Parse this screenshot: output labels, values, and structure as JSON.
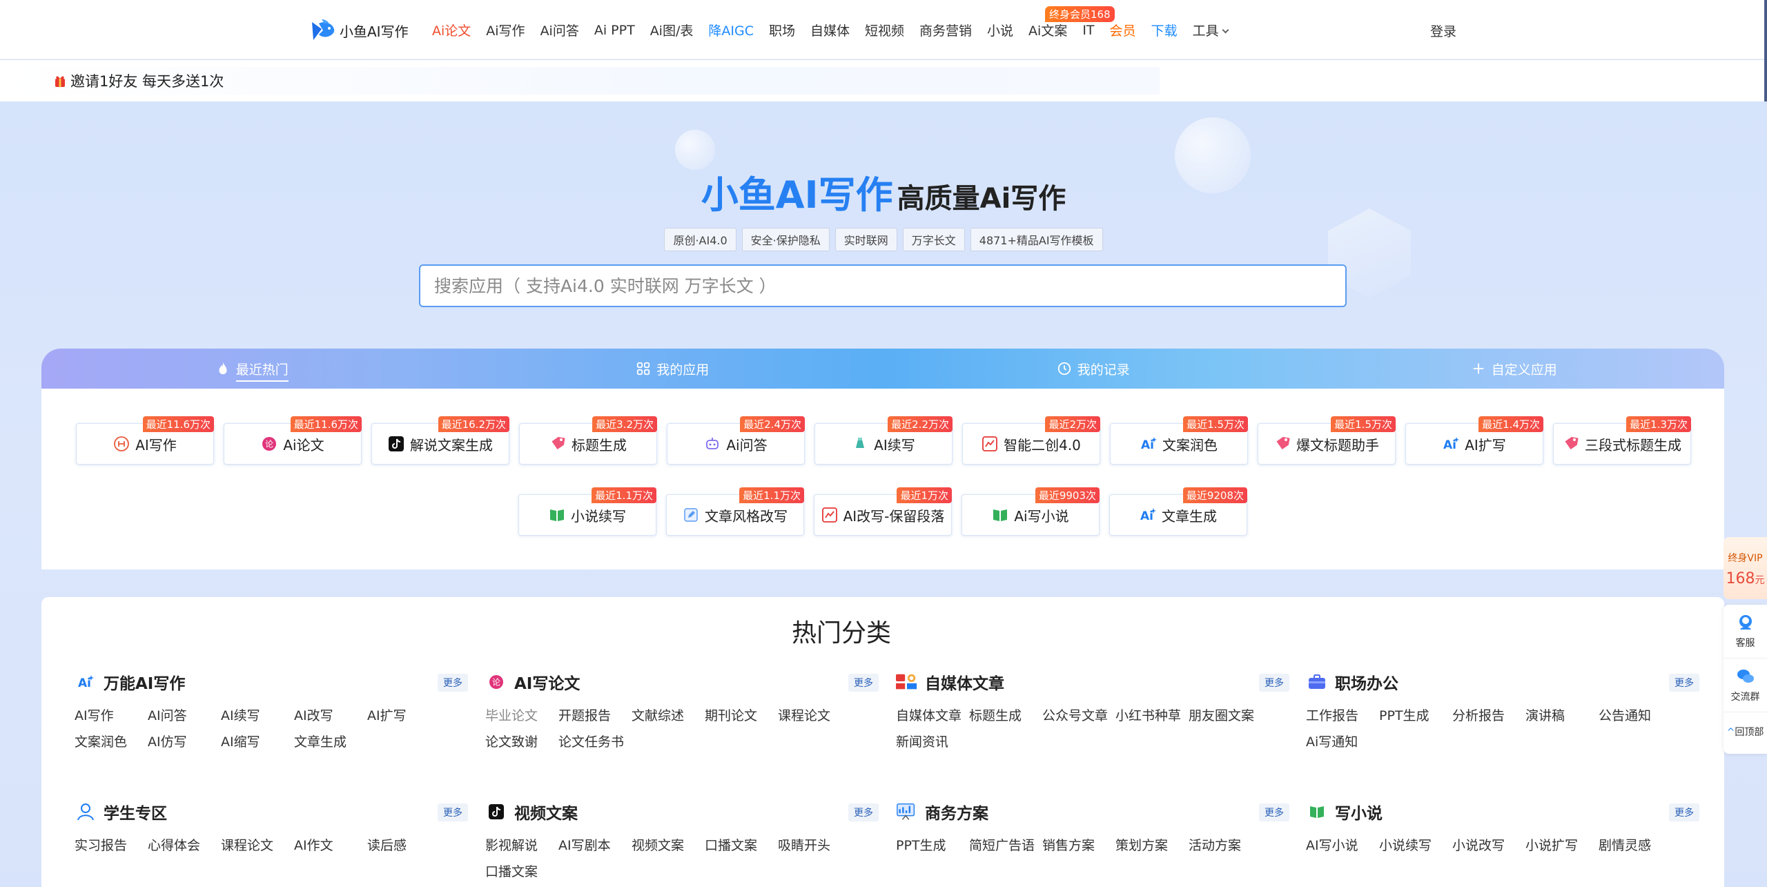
{
  "nav": {
    "brand": "小鱼AI写作",
    "items": [
      {
        "label": "Ai论文",
        "color": "red"
      },
      {
        "label": "Ai写作",
        "color": ""
      },
      {
        "label": "Ai问答",
        "color": ""
      },
      {
        "label": "Ai PPT",
        "color": ""
      },
      {
        "label": "Ai图/表",
        "color": ""
      },
      {
        "label": "降AIGC",
        "color": "blue"
      },
      {
        "label": "职场",
        "color": ""
      },
      {
        "label": "自媒体",
        "color": ""
      },
      {
        "label": "短视频",
        "color": ""
      },
      {
        "label": "商务营销",
        "color": ""
      },
      {
        "label": "小说",
        "color": ""
      },
      {
        "label": "Ai文案",
        "color": ""
      },
      {
        "label": "IT",
        "color": ""
      },
      {
        "label": "会员",
        "color": "orange"
      },
      {
        "label": "下载",
        "color": "blue"
      },
      {
        "label": "工具",
        "color": ""
      }
    ],
    "vip_badge": "终身会员168",
    "login": "登录"
  },
  "invite": {
    "text": "邀请1好友 每天多送1次"
  },
  "hero": {
    "title_main": "小鱼AI写作",
    "title_sub": "高质量Ai写作",
    "tags": [
      "原创·AI4.0",
      "安全·保护隐私",
      "实时联网",
      "万字长文",
      "4871+精品AI写作模板"
    ],
    "search_placeholder": "搜索应用（ 支持Ai4.0 实时联网 万字长文 ）"
  },
  "tabs": [
    {
      "label": "最近热门",
      "icon": "flame-icon"
    },
    {
      "label": "我的应用",
      "icon": "grid-icon"
    },
    {
      "label": "我的记录",
      "icon": "clock-icon"
    },
    {
      "label": "自定义应用",
      "icon": "plus-icon"
    }
  ],
  "apps": [
    {
      "label": "AI写作",
      "badge": "最近11.6万次",
      "icon": "write-icon"
    },
    {
      "label": "Ai论文",
      "badge": "最近11.6万次",
      "icon": "thesis-icon"
    },
    {
      "label": "解说文案生成",
      "badge": "最近16.2万次",
      "icon": "tiktok-icon"
    },
    {
      "label": "标题生成",
      "badge": "最近3.2万次",
      "icon": "tag-icon"
    },
    {
      "label": "Ai问答",
      "badge": "最近2.4万次",
      "icon": "robot-icon"
    },
    {
      "label": "AI续写",
      "badge": "最近2.2万次",
      "icon": "pen-icon"
    },
    {
      "label": "智能二创4.0",
      "badge": "最近2万次",
      "icon": "chart-icon"
    },
    {
      "label": "文案润色",
      "badge": "最近1.5万次",
      "icon": "ai-spark-icon"
    },
    {
      "label": "爆文标题助手",
      "badge": "最近1.5万次",
      "icon": "tag-icon"
    },
    {
      "label": "AI扩写",
      "badge": "最近1.4万次",
      "icon": "ai-spark-icon"
    },
    {
      "label": "三段式标题生成",
      "badge": "最近1.3万次",
      "icon": "tag-icon"
    },
    {
      "label": "小说续写",
      "badge": "最近1.1万次",
      "icon": "book-icon"
    },
    {
      "label": "文章风格改写",
      "badge": "最近1.1万次",
      "icon": "edit-icon"
    },
    {
      "label": "AI改写-保留段落",
      "badge": "最近1万次",
      "icon": "chart-icon"
    },
    {
      "label": "Ai写小说",
      "badge": "最近9903次",
      "icon": "book-icon"
    },
    {
      "label": "文章生成",
      "badge": "最近9208次",
      "icon": "ai-spark-icon"
    }
  ],
  "categories_title": "热门分类",
  "categories": [
    {
      "title": "万能AI写作",
      "icon": "ai-spark-icon",
      "more": "更多",
      "links": [
        "AI写作",
        "AI问答",
        "AI续写",
        "AI改写",
        "AI扩写",
        "文案润色",
        "AI仿写",
        "AI缩写",
        "文章生成"
      ]
    },
    {
      "title": "AI写论文",
      "icon": "thesis-icon",
      "more": "更多",
      "links": [
        "毕业论文",
        "开题报告",
        "文献综述",
        "期刊论文",
        "课程论文",
        "论文致谢",
        "论文任务书"
      ]
    },
    {
      "title": "自媒体文章",
      "icon": "media-icon",
      "more": "更多",
      "links": [
        "自媒体文章",
        "标题生成",
        "公众号文章",
        "小红书种草",
        "朋友圈文案",
        "新闻资讯"
      ]
    },
    {
      "title": "职场办公",
      "icon": "briefcase-icon",
      "more": "更多",
      "links": [
        "工作报告",
        "PPT生成",
        "分析报告",
        "演讲稿",
        "公告通知",
        "Ai写通知"
      ]
    },
    {
      "title": "学生专区",
      "icon": "student-icon",
      "more": "更多",
      "links": [
        "实习报告",
        "心得体会",
        "课程论文",
        "AI作文",
        "读后感"
      ]
    },
    {
      "title": "视频文案",
      "icon": "tiktok-icon",
      "more": "更多",
      "links": [
        "影视解说",
        "AI写剧本",
        "视频文案",
        "口播文案",
        "吸睛开头",
        "口播文案"
      ]
    },
    {
      "title": "商务方案",
      "icon": "business-icon",
      "more": "更多",
      "links": [
        "PPT生成",
        "简短广告语",
        "销售方案",
        "策划方案",
        "活动方案"
      ]
    },
    {
      "title": "写小说",
      "icon": "book-icon",
      "more": "更多",
      "links": [
        "AI写小说",
        "小说续写",
        "小说改写",
        "小说扩写",
        "剧情灵感"
      ]
    }
  ],
  "float": {
    "vip_label": "终身VIP",
    "vip_price": "168",
    "vip_unit": "元",
    "service": "客服",
    "group": "交流群",
    "top": "回顶部"
  }
}
